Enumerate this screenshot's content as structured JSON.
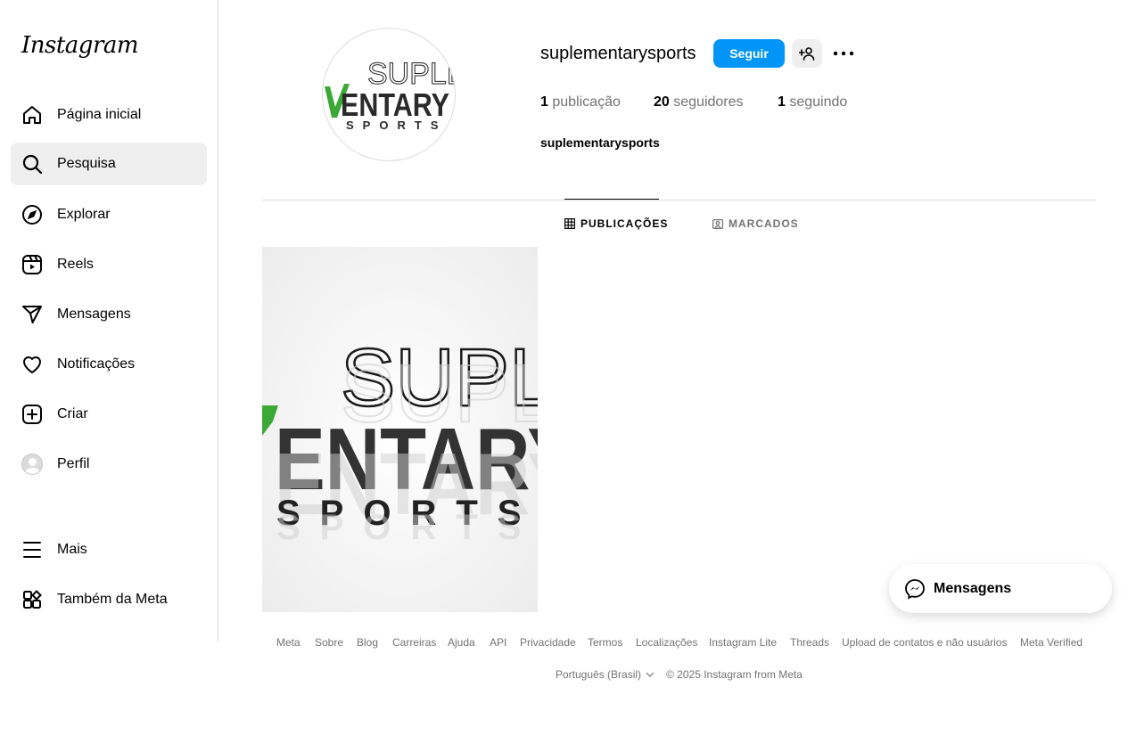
{
  "app": {
    "logo_text": "Instagram"
  },
  "sidebar": {
    "items": [
      {
        "label": "Página inicial",
        "icon": "home-icon"
      },
      {
        "label": "Pesquisa",
        "icon": "search-icon",
        "active": true
      },
      {
        "label": "Explorar",
        "icon": "compass-icon"
      },
      {
        "label": "Reels",
        "icon": "reels-icon"
      },
      {
        "label": "Mensagens",
        "icon": "send-icon"
      },
      {
        "label": "Notificações",
        "icon": "heart-icon"
      },
      {
        "label": "Criar",
        "icon": "plus-square-icon"
      },
      {
        "label": "Perfil",
        "icon": "avatar"
      }
    ],
    "more_label": "Mais",
    "meta_label": "Também da Meta"
  },
  "profile": {
    "username": "suplementarysports",
    "follow_label": "Seguir",
    "stats": {
      "posts_count": "1",
      "posts_label": "publicação",
      "followers_count": "20",
      "followers_label": "seguidores",
      "following_count": "1",
      "following_label": "seguindo"
    },
    "display_name": "suplementarysports",
    "logo_lines": [
      "SUPLE",
      "ENTARY",
      "SPORTS"
    ]
  },
  "tabs": [
    {
      "label": "PUBLICAÇÕES",
      "icon": "grid-icon",
      "active": true
    },
    {
      "label": "MARCADOS",
      "icon": "tagged-icon"
    }
  ],
  "footer": {
    "links": [
      "Meta",
      "Sobre",
      "Blog",
      "Carreiras",
      "Ajuda",
      "API",
      "Privacidade",
      "Termos",
      "Localizações",
      "Instagram Lite",
      "Threads",
      "Upload de contatos e não usuários",
      "Meta Verified"
    ],
    "language": "Português (Brasil)",
    "copyright": "© 2025 Instagram from Meta"
  },
  "messages_widget": {
    "label": "Mensagens"
  },
  "colors": {
    "accent": "#0095f6",
    "muted": "#737373",
    "border": "#dbdbdb",
    "brand_green": "#3aa935"
  }
}
